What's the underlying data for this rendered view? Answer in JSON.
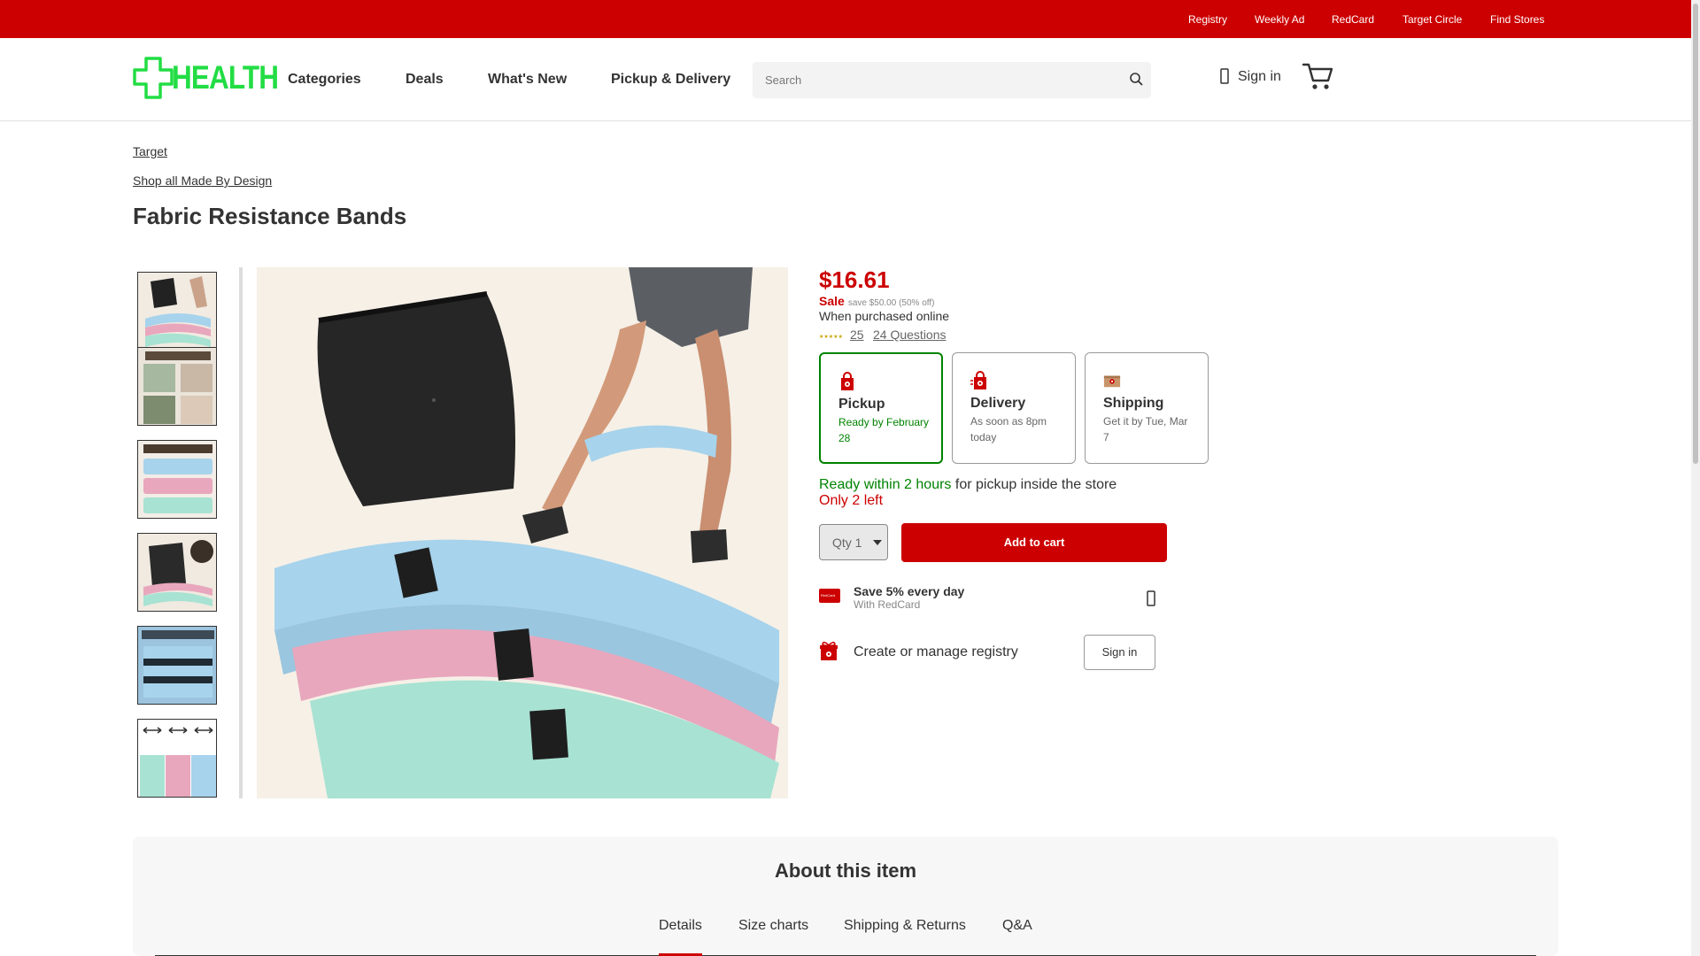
{
  "topbar": {
    "links": [
      "Registry",
      "Weekly Ad",
      "RedCard",
      "Target Circle",
      "Find Stores"
    ]
  },
  "header": {
    "logo_text": "HEALTH",
    "nav": [
      "Categories",
      "Deals",
      "What's New",
      "Pickup & Delivery"
    ],
    "search_placeholder": "Search",
    "signin_label": "Sign in",
    "icons": {
      "search": "search-icon",
      "account": "person-icon",
      "cart": "cart-icon"
    }
  },
  "breadcrumbs": [
    "Target",
    "Shop all Made By Design"
  ],
  "product": {
    "title": "Fabric Resistance Bands",
    "price": "$16.61",
    "sale_label": "Sale",
    "save_text": "save $50.00 (50% off)",
    "when_purchased": "When purchased online",
    "rating_count": "25",
    "questions": "24 Questions"
  },
  "fulfillment": [
    {
      "name": "Pickup",
      "sub": "Ready by February 28",
      "selected": true,
      "icon": "pickup-bag-icon"
    },
    {
      "name": "Delivery",
      "sub": "As soon as 8pm today",
      "selected": false,
      "icon": "delivery-bag-icon"
    },
    {
      "name": "Shipping",
      "sub": "Get it by Tue, Mar 7",
      "selected": false,
      "icon": "shipping-box-icon"
    }
  ],
  "availability": {
    "ready_green": "Ready within 2 hours",
    "ready_rest": " for pickup inside the store",
    "stock": "Only 2 left"
  },
  "cart": {
    "qty_label": "Qty 1",
    "add_label": "Add to cart"
  },
  "redcard": {
    "title": "Save 5% every day",
    "sub": "With RedCard",
    "card_text": "RedCard"
  },
  "registry": {
    "text": "Create or manage registry",
    "button": "Sign in"
  },
  "about": {
    "heading": "About this item",
    "tabs": [
      "Details",
      "Size charts",
      "Shipping & Returns",
      "Q&A"
    ],
    "active_tab": "Details"
  },
  "colors": {
    "brand_red": "#cc0000",
    "logo_green": "#22dd44",
    "success_green": "#008300",
    "band_blue": "#a7d3ec",
    "band_pink": "#e8a7bd",
    "band_mint": "#a8e2d2"
  }
}
